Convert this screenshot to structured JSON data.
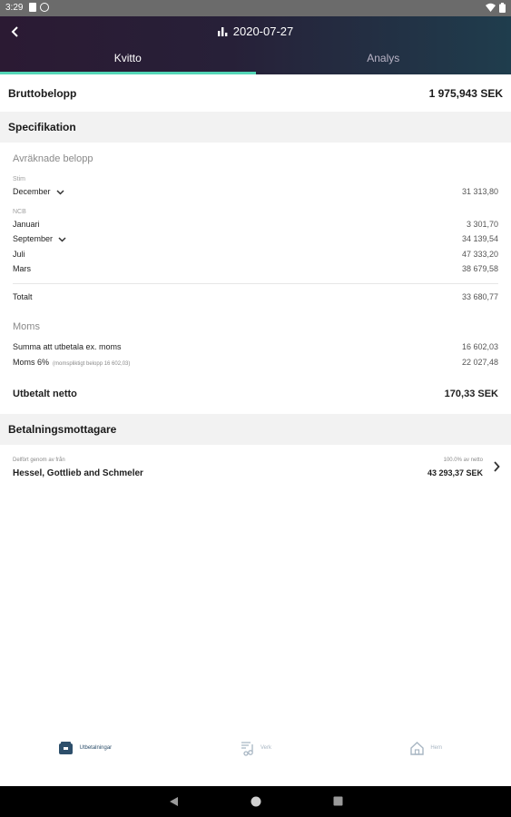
{
  "status_bar": {
    "time": "3:29"
  },
  "header": {
    "title": "2020-07-27",
    "back_icon": "chevron-left-icon",
    "title_icon": "bar-chart-icon"
  },
  "tabs": [
    {
      "label": "Kvitto",
      "active": true
    },
    {
      "label": "Analys",
      "active": false
    }
  ],
  "brutto": {
    "label": "Bruttobelopp",
    "value": "1 975,943 SEK"
  },
  "specifikation": {
    "heading": "Specifikation",
    "avraknade_label": "Avräknade belopp",
    "groups": [
      {
        "name": "Stim",
        "rows": [
          {
            "label": "December",
            "value": "31 313,80",
            "expandable": true
          }
        ]
      },
      {
        "name": "NCB",
        "rows": [
          {
            "label": "Januari",
            "value": "3 301,70",
            "expandable": false
          },
          {
            "label": "September",
            "value": "34 139,54",
            "expandable": true
          },
          {
            "label": "Juli",
            "value": "47 333,20",
            "expandable": false
          },
          {
            "label": "Mars",
            "value": "38 679,58",
            "expandable": false
          }
        ]
      }
    ],
    "total_label": "Totalt",
    "total_value": "33 680,77",
    "moms_label": "Moms",
    "summa_label": "Summa att utbetala ex. moms",
    "summa_value": "16 602,03",
    "moms_row_label": "Moms 6%",
    "moms_row_note": "(momspliktigt belopp 16 602,03)",
    "moms_row_value": "22 027,48",
    "netto_label": "Utbetalt netto",
    "netto_value": "170,33 SEK"
  },
  "betalning": {
    "heading": "Betalningsmottagare",
    "payee_small": "Delfört genom av från",
    "payee_name": "Hessel, Gottlieb and Schmeler",
    "payee_pct": "100.0% av netto",
    "payee_amount": "43 293,37 SEK"
  },
  "bottom_nav": [
    {
      "label": "Utbetalningar",
      "icon": "payments-icon",
      "active": true
    },
    {
      "label": "Verk",
      "icon": "music-note-icon",
      "active": false
    },
    {
      "label": "Hem",
      "icon": "home-icon",
      "active": false
    }
  ],
  "colors": {
    "accent": "#53d6b7",
    "header_dark": "#2b1a33",
    "header_teal": "#1f3d4d",
    "nav_active": "#2d4f6b"
  }
}
